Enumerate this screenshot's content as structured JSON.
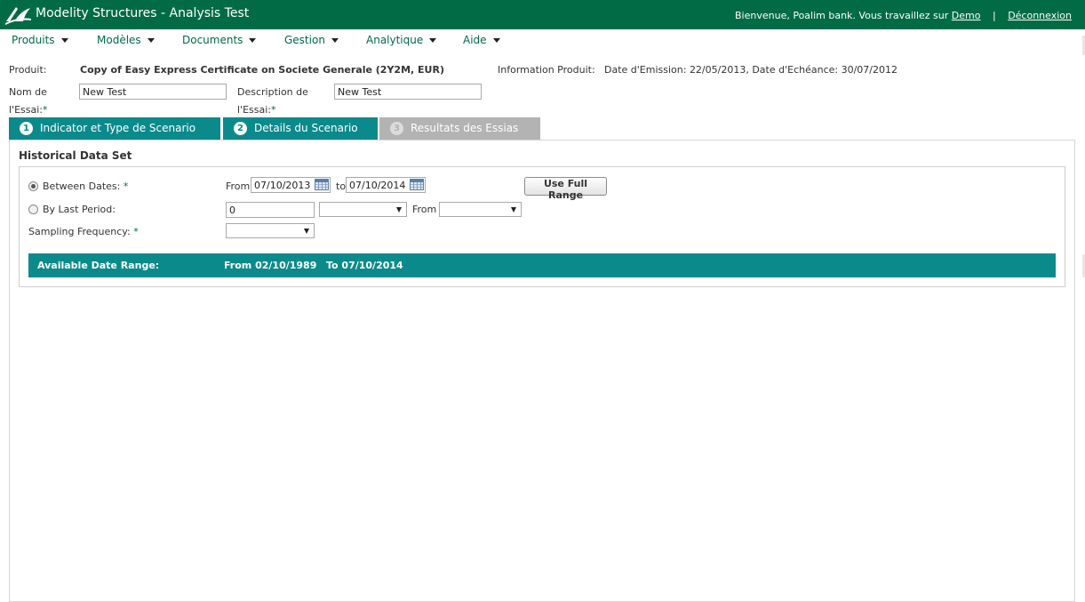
{
  "header": {
    "app_title": "Modelity Structures - Analysis Test",
    "welcome": "Bienvenue, Poalim bank. Vous travaillez sur",
    "env_link": "Demo",
    "separator": "|",
    "logout": "Déconnexion"
  },
  "menu": [
    "Produits",
    "Modèles",
    "Documents",
    "Gestion",
    "Analytique",
    "Aide"
  ],
  "product": {
    "label": "Produit:",
    "name": "Copy of Easy Express Certificate on Societe Generale (2Y2M, EUR)",
    "info_label": "Information Produit:",
    "info_value": "Date d'Emission: 22/05/2013, Date d'Echéance: 30/07/2012"
  },
  "test": {
    "name_label_line1": "Nom de",
    "name_label_line2": "l'Essai:",
    "name_value": "New Test",
    "desc_label_line1": "Description de",
    "desc_label_line2": "l'Essai:",
    "desc_value": "New Test",
    "required_marker": "*"
  },
  "tabs": [
    {
      "num": "1",
      "label": "Indicator et Type de Scenario",
      "state": "active"
    },
    {
      "num": "2",
      "label": "Details du Scenario",
      "state": "active"
    },
    {
      "num": "3",
      "label": "Resultats des Essias",
      "state": "disabled"
    }
  ],
  "historical": {
    "title": "Historical Data Set",
    "between_dates_label": "Between Dates:",
    "from_label": "From",
    "from_date": "07/10/2013",
    "to_label": "to",
    "to_date": "07/10/2014",
    "use_full_range": "Use Full Range",
    "by_last_period_label": "By Last Period:",
    "last_period_value": "0",
    "period_from_label": "From",
    "sampling_label": "Sampling Frequency:",
    "selected_mode": "between_dates"
  },
  "available_range": {
    "label": "Available Date Range:",
    "from": "From 02/10/1989",
    "to": "To 07/10/2014"
  },
  "colors": {
    "header_green": "#006b45",
    "tab_teal": "#0b8a8c",
    "tab_disabled": "#b3b3b3"
  }
}
